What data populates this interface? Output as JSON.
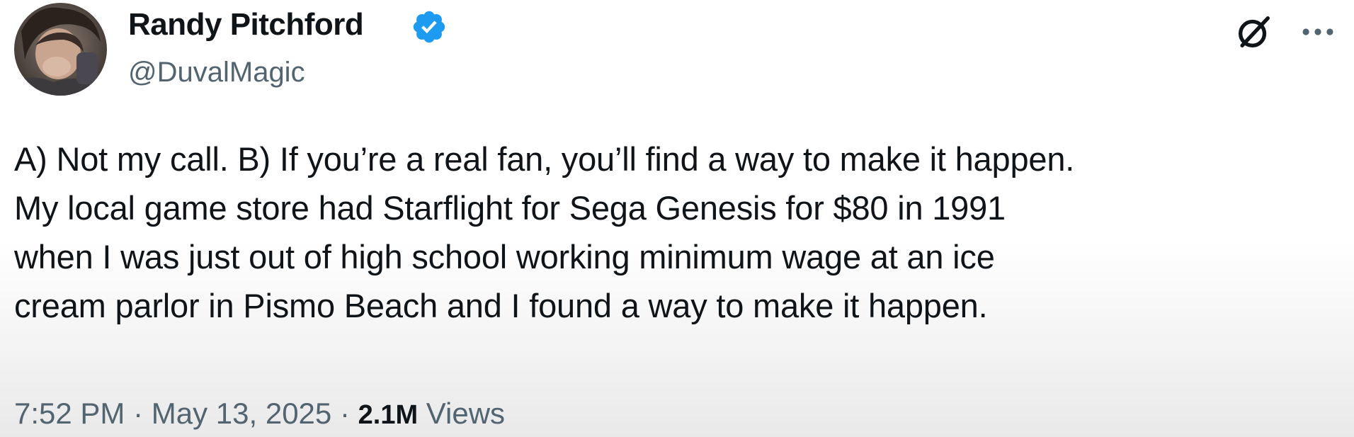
{
  "author": {
    "display_name": "Randy Pitchford",
    "handle": "@DuvalMagic",
    "verified": true,
    "avatar_icon": "profile-photo"
  },
  "actions": {
    "grok_icon": "grok-icon",
    "more_icon": "more-icon"
  },
  "tweet": {
    "text": "A) Not my call. B) If you’re a real fan, you’ll find a way to make it happen.\nMy local game store had Starflight for Sega Genesis for $80 in 1991\nwhen I was just out of high school working minimum wage at an ice\ncream parlor in Pismo Beach and I found a way to make it happen."
  },
  "meta": {
    "time": "7:52 PM",
    "separator": "·",
    "date": "May 13, 2025",
    "views_count": "2.1M",
    "views_label": "Views"
  },
  "colors": {
    "verified_badge": "#1d9bf0",
    "secondary_text": "#536471",
    "primary_text": "#0f1419"
  }
}
